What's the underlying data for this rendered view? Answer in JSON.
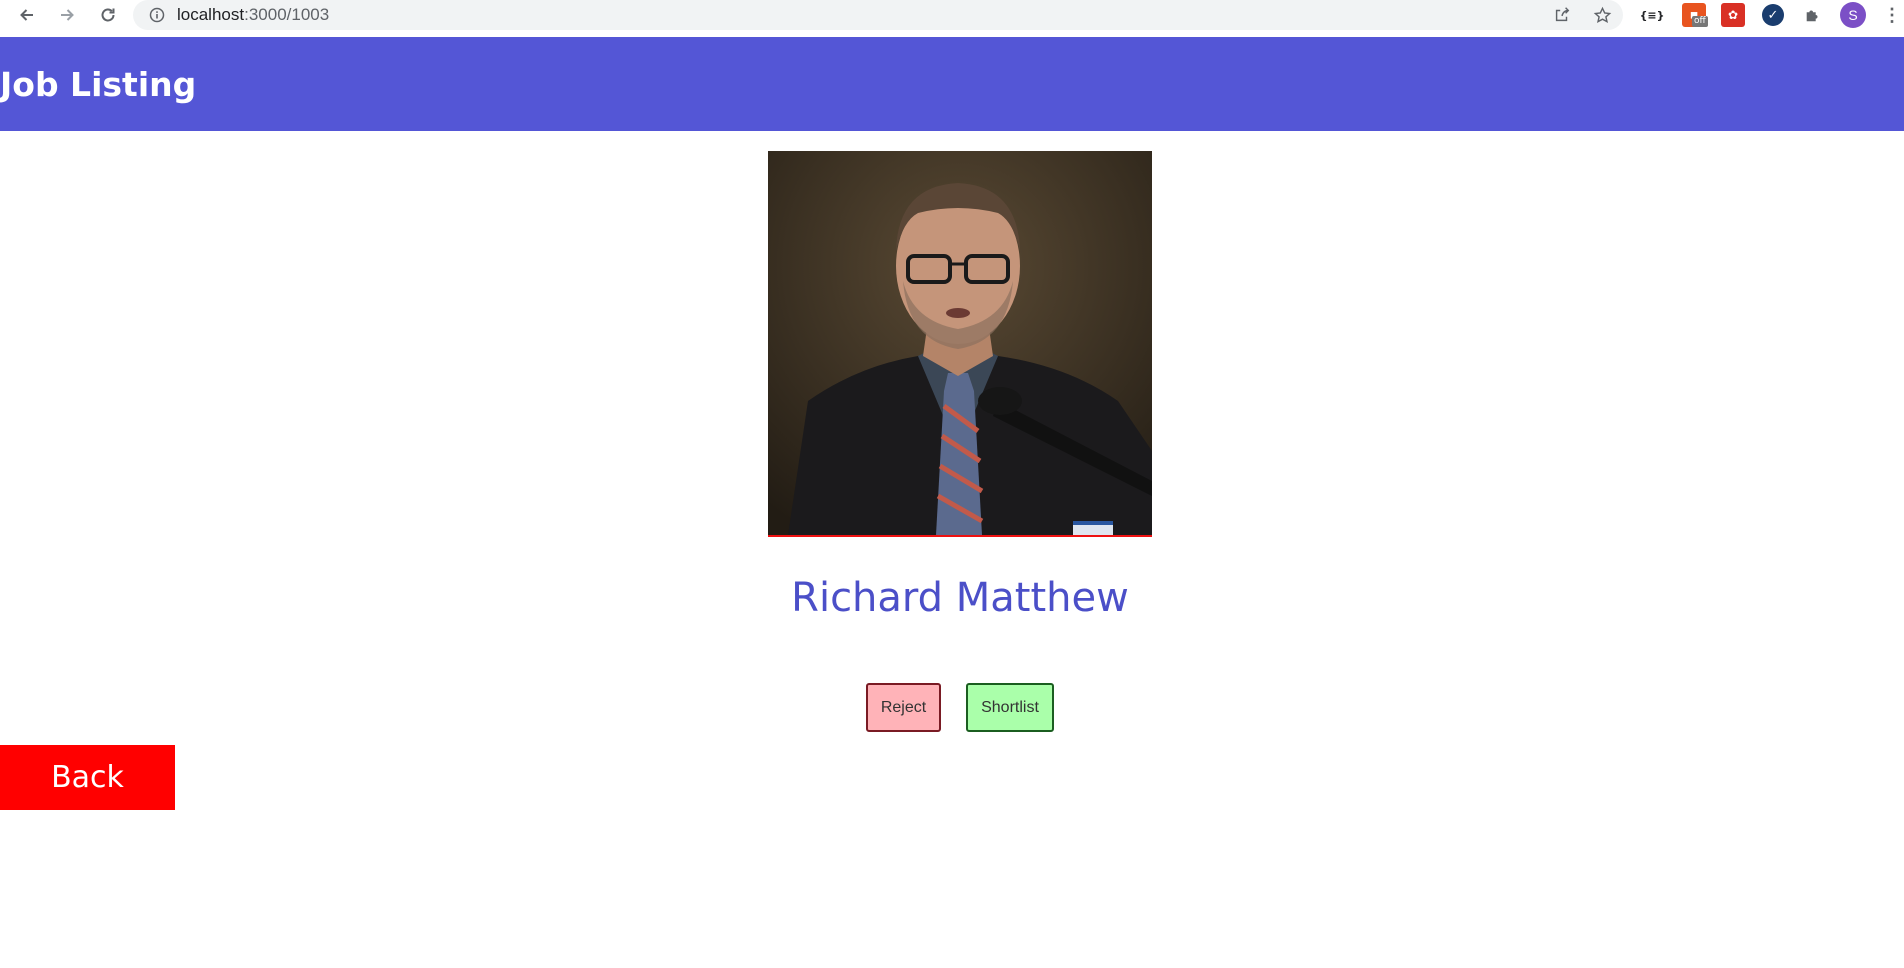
{
  "browser": {
    "url_host": "localhost",
    "url_path": ":3000/1003",
    "extensions": {
      "json_label": "{≡}",
      "off_badge": "off"
    },
    "profile_initial": "S"
  },
  "header": {
    "title": "Job Listing",
    "background_color": "#5456d6"
  },
  "candidate": {
    "name": "Richard Matthew",
    "name_color": "#4b4fc8"
  },
  "actions": {
    "reject_label": "Reject",
    "shortlist_label": "Shortlist",
    "reject_color": "#ffb3b8",
    "shortlist_color": "#aaffaa"
  },
  "back": {
    "label": "Back",
    "color": "#ff0000"
  }
}
